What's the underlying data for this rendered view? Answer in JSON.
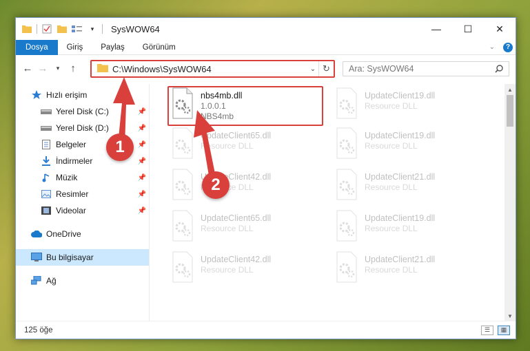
{
  "window": {
    "title": "SysWOW64"
  },
  "window_controls": {
    "minimize": "—",
    "maximize": "☐",
    "close": "✕"
  },
  "ribbon": {
    "tabs": [
      {
        "label": "Dosya",
        "active": true
      },
      {
        "label": "Giriş"
      },
      {
        "label": "Paylaş"
      },
      {
        "label": "Görünüm"
      }
    ],
    "expand_icon": "chevron-down-icon",
    "help_label": "?"
  },
  "address": {
    "path": "C:\\Windows\\SysWOW64"
  },
  "search": {
    "placeholder": "Ara: SysWOW64"
  },
  "sidebar": {
    "quick_access": "Hızlı erişim",
    "items": [
      {
        "label": "Yerel Disk (C:)",
        "icon": "drive-icon"
      },
      {
        "label": "Yerel Disk (D:)",
        "icon": "drive-icon"
      },
      {
        "label": "Belgeler",
        "icon": "documents-icon"
      },
      {
        "label": "İndirmeler",
        "icon": "download-icon"
      },
      {
        "label": "Müzik",
        "icon": "music-icon"
      },
      {
        "label": "Resimler",
        "icon": "pictures-icon"
      },
      {
        "label": "Videolar",
        "icon": "video-icon"
      }
    ],
    "onedrive": "OneDrive",
    "this_pc": "Bu bilgisayar",
    "network": "Ağ"
  },
  "files": [
    {
      "name": "nbs4mb.dll",
      "line2": "1.0.0.1",
      "line3": "NBS4mb",
      "highlighted": true
    },
    {
      "name": "UpdateClient19.dll",
      "line2": "Resource DLL"
    },
    {
      "name": "UpdateClient65.dll",
      "line2": "Resource DLL"
    },
    {
      "name": "UpdateClient19.dll",
      "line2": "Resource DLL"
    },
    {
      "name": "UpdateClient42.dll",
      "line2": "Resource DLL"
    },
    {
      "name": "UpdateClient21.dll",
      "line2": "Resource DLL"
    },
    {
      "name": "UpdateClient65.dll",
      "line2": "Resource DLL"
    },
    {
      "name": "UpdateClient19.dll",
      "line2": "Resource DLL"
    },
    {
      "name": "UpdateClient42.dll",
      "line2": "Resource DLL"
    },
    {
      "name": "UpdateClient21.dll",
      "line2": "Resource DLL"
    }
  ],
  "status": {
    "count": "125 öğe"
  },
  "annotations": {
    "badge1": "1",
    "badge2": "2"
  },
  "colors": {
    "accent": "#1979ca",
    "annotation": "#d9403c",
    "selected": "#cce8ff"
  }
}
